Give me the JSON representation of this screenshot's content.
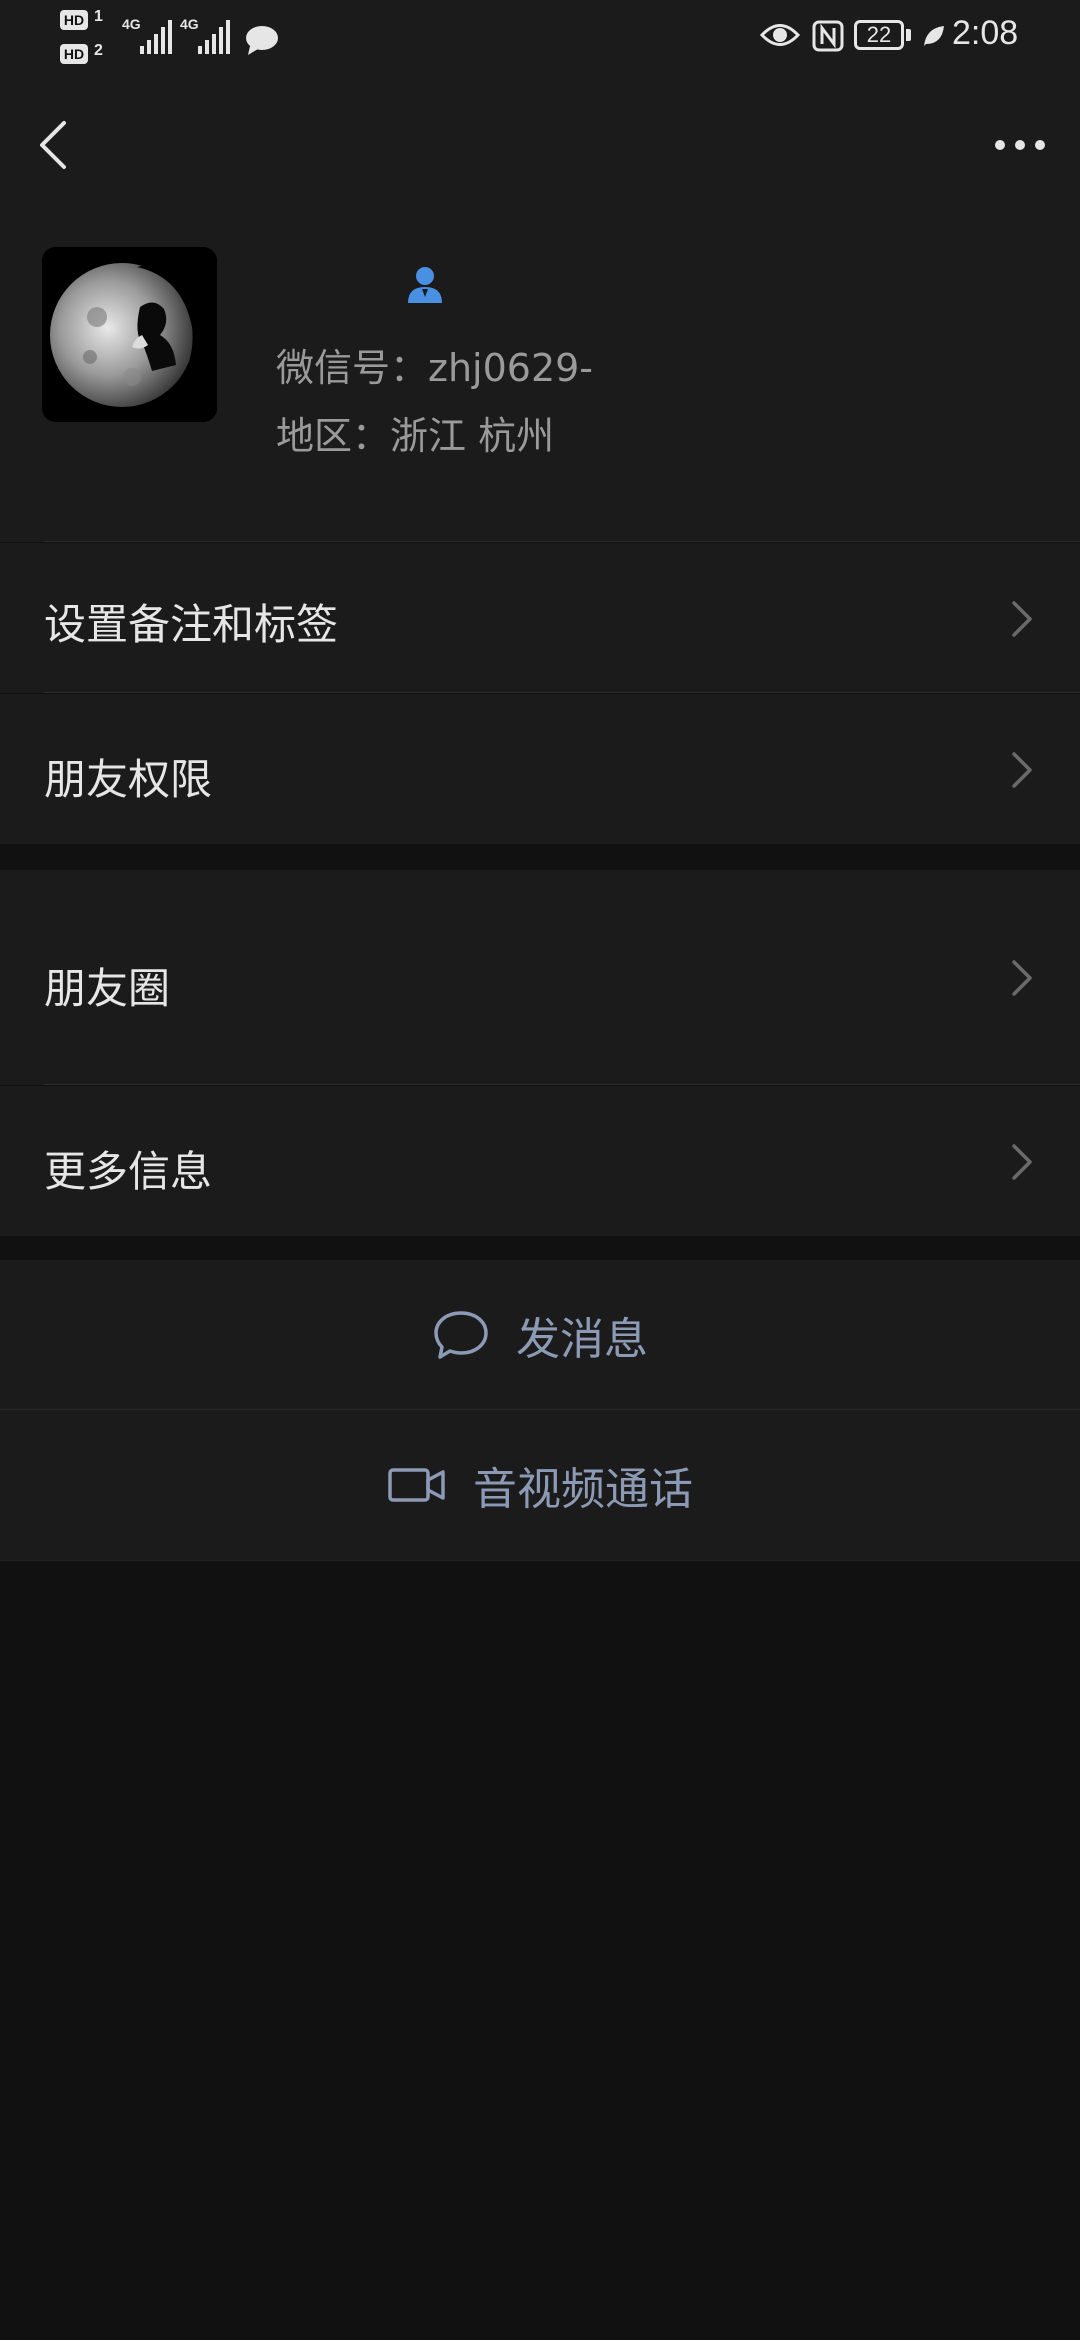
{
  "status_bar": {
    "hd1_label": "HD",
    "hd1_num": "1",
    "hd2_label": "HD",
    "hd2_num": "2",
    "net1_label": "4G",
    "net2_label": "4G",
    "battery_level": "22",
    "time": "2:08",
    "icons": [
      "chat-bubble-icon",
      "eye-icon",
      "nfc-icon",
      "battery-icon",
      "leaf-icon"
    ]
  },
  "header": {
    "back_icon": "chevron-left-icon",
    "more_icon": "more-dots-icon"
  },
  "profile": {
    "name_icon": "person-icon",
    "name_icon_color": "#4a90e2",
    "wechat_id": "微信号：zhj0629-",
    "region": "地区：浙江  杭州"
  },
  "menu": {
    "remarks_tags": "设置备注和标签",
    "friend_permissions": "朋友权限",
    "moments": "朋友圈",
    "more_info": "更多信息"
  },
  "actions": {
    "send_message": "发消息",
    "video_call": "音视频通话",
    "accent_color": "#8c9ab5"
  }
}
